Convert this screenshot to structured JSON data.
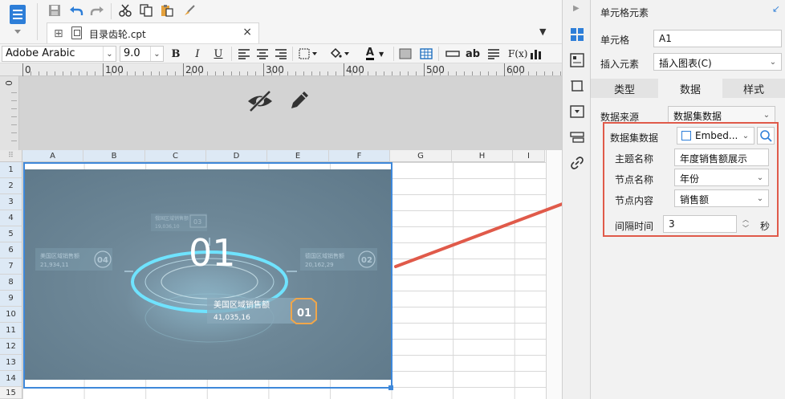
{
  "tab": {
    "label": "目录齿轮.cpt"
  },
  "format": {
    "font_family": "Adobe Arabic",
    "font_size": "9.0",
    "bold": "B",
    "italic": "I",
    "underline": "U",
    "text_color_glyph": "A",
    "wrap_label": "ab",
    "formula_label": "F(x)"
  },
  "ruler": {
    "marks": [
      "0",
      "100",
      "200",
      "300",
      "400",
      "500",
      "600"
    ],
    "vertical_mark": "0"
  },
  "grid": {
    "corner": "⠿",
    "columns": [
      "A",
      "B",
      "C",
      "D",
      "E",
      "F",
      "G",
      "H",
      "I"
    ],
    "rows": [
      "1",
      "2",
      "3",
      "4",
      "5",
      "6",
      "7",
      "8",
      "9",
      "10",
      "11",
      "12",
      "13",
      "14",
      "15"
    ]
  },
  "chart_image": {
    "main_number": "01",
    "card_top": {
      "title": "俄国区域销售额",
      "value": "19,036,10",
      "badge": "03"
    },
    "card_left": {
      "title": "美国区域销售额",
      "value": "21,934,11",
      "badge": "04"
    },
    "card_right": {
      "title": "德国区域销售额",
      "value": "20,162,29",
      "badge": "02"
    },
    "card_bottom": {
      "title": "美国区域销售额",
      "value": "41,035,16",
      "badge": "01"
    }
  },
  "panel": {
    "title": "单元格元素",
    "cell_label": "单元格",
    "cell_value": "A1",
    "insert_label": "插入元素",
    "insert_value": "插入图表(C)",
    "tabs": [
      "类型",
      "数据",
      "样式"
    ],
    "data_source_label": "数据来源",
    "data_source_value": "数据集数据",
    "dataset_label": "数据集数据",
    "dataset_value": "Embed...",
    "topic_label": "主题名称",
    "topic_value": "年度销售额展示",
    "node_name_label": "节点名称",
    "node_name_value": "年份",
    "node_content_label": "节点内容",
    "node_content_value": "销售额",
    "interval_label": "间隔时间",
    "interval_value": "3",
    "interval_unit": "秒"
  },
  "colors": {
    "accent": "#3e88da",
    "highlight_red": "#e05a4a",
    "chart_bg": "#6d8797",
    "ring_cyan": "#6fe3ff",
    "orange_badge": "#f0a64a"
  }
}
